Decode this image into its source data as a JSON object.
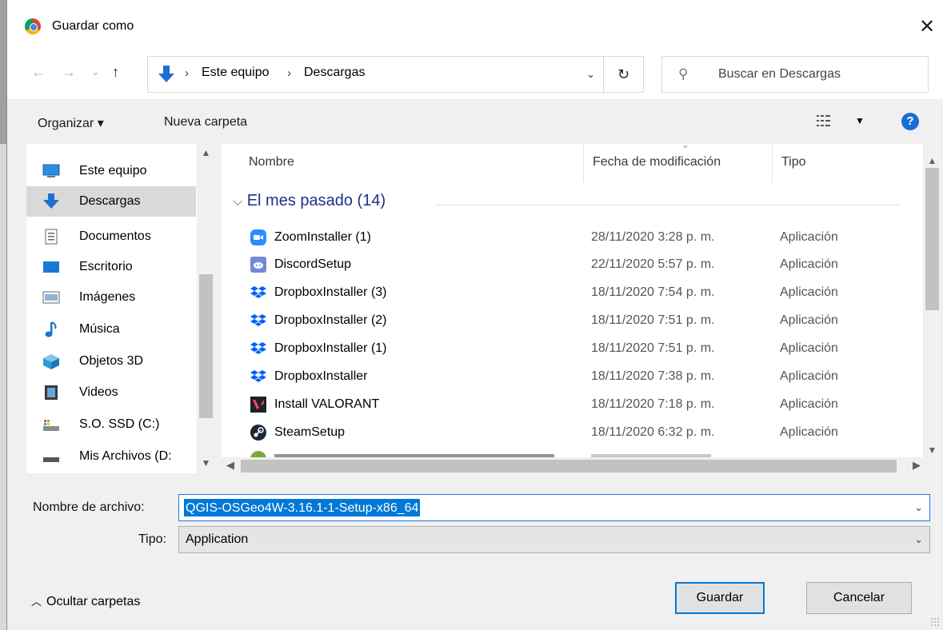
{
  "window": {
    "title": "Guardar como",
    "close_glyph": "✕"
  },
  "nav": {
    "back_glyph": "←",
    "forward_glyph": "→",
    "recent_glyph": "⌄",
    "up_glyph": "↑",
    "breadcrumbs": [
      "Este equipo",
      "Descargas"
    ],
    "separator": "›",
    "dropdown_glyph": "⌄",
    "refresh_glyph": "↻",
    "search_placeholder": "Buscar en Descargas"
  },
  "toolbar": {
    "organize_label": "Organizar ▾",
    "new_folder_label": "Nueva carpeta",
    "view_caret": "▼",
    "help_glyph": "?"
  },
  "sidebar": {
    "items": [
      {
        "label": "Este equipo",
        "icon": "computer-icon"
      },
      {
        "label": "Descargas",
        "icon": "downloads-icon",
        "selected": true
      },
      {
        "label": "Documentos",
        "icon": "documents-icon"
      },
      {
        "label": "Escritorio",
        "icon": "desktop-icon"
      },
      {
        "label": "Imágenes",
        "icon": "pictures-icon"
      },
      {
        "label": "Música",
        "icon": "music-icon"
      },
      {
        "label": "Objetos 3D",
        "icon": "3d-objects-icon"
      },
      {
        "label": "Videos",
        "icon": "videos-icon"
      },
      {
        "label": "S.O. SSD (C:)",
        "icon": "drive-c-icon"
      },
      {
        "label": "Mis Archivos (D:",
        "icon": "drive-d-icon"
      }
    ]
  },
  "filelist": {
    "columns": [
      "Nombre",
      "Fecha de modificación",
      "Tipo"
    ],
    "group_label": "El mes pasado (14)",
    "rows": [
      {
        "name": "ZoomInstaller (1)",
        "date": "28/11/2020 3:28 p. m.",
        "type": "Aplicación",
        "icon": "zoom-icon"
      },
      {
        "name": "DiscordSetup",
        "date": "22/11/2020 5:57 p. m.",
        "type": "Aplicación",
        "icon": "discord-icon"
      },
      {
        "name": "DropboxInstaller (3)",
        "date": "18/11/2020 7:54 p. m.",
        "type": "Aplicación",
        "icon": "dropbox-icon"
      },
      {
        "name": "DropboxInstaller (2)",
        "date": "18/11/2020 7:51 p. m.",
        "type": "Aplicación",
        "icon": "dropbox-icon"
      },
      {
        "name": "DropboxInstaller (1)",
        "date": "18/11/2020 7:51 p. m.",
        "type": "Aplicación",
        "icon": "dropbox-icon"
      },
      {
        "name": "DropboxInstaller",
        "date": "18/11/2020 7:38 p. m.",
        "type": "Aplicación",
        "icon": "dropbox-icon"
      },
      {
        "name": "Install VALORANT",
        "date": "18/11/2020 7:18 p. m.",
        "type": "Aplicación",
        "icon": "valorant-icon"
      },
      {
        "name": "SteamSetup",
        "date": "18/11/2020 6:32 p. m.",
        "type": "Aplicación",
        "icon": "steam-icon"
      }
    ]
  },
  "form": {
    "filename_label": "Nombre de archivo:",
    "filename_value": "QGIS-OSGeo4W-3.16.1-1-Setup-x86_64",
    "type_label": "Tipo:",
    "type_value": "Application"
  },
  "footer": {
    "hide_folders_label": "Ocultar carpetas",
    "save_label": "Guardar",
    "cancel_label": "Cancelar"
  },
  "colors": {
    "accent": "#0078d7",
    "group_header": "#1e3287",
    "selection": "#d9d9d9"
  }
}
